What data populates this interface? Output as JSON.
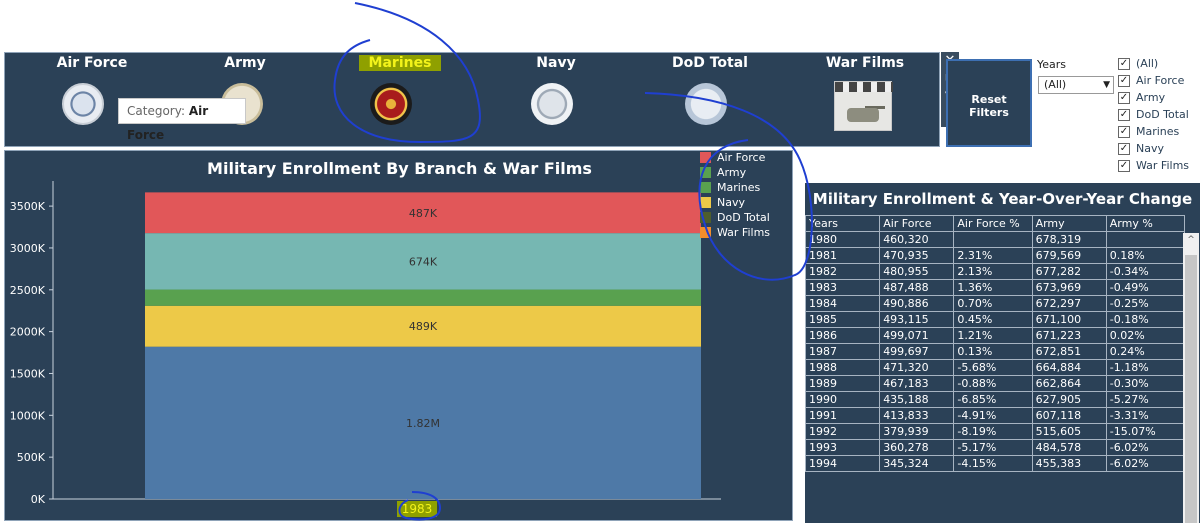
{
  "branches": [
    {
      "label": "Air Force",
      "center": 87,
      "seal": "air-force-seal"
    },
    {
      "label": "Army",
      "center": 240,
      "seal": "army-seal"
    },
    {
      "label": "Marines",
      "center": 395,
      "seal": "marines-seal"
    },
    {
      "label": "Navy",
      "center": 551,
      "seal": "navy-seal"
    },
    {
      "label": "DoD Total",
      "center": 705,
      "seal": "dod-seal"
    },
    {
      "label": "War Films",
      "center": 860,
      "seal": "war-films-image"
    }
  ],
  "active_branch": "Marines",
  "tooltip": {
    "prefix": "Category:",
    "value": "Air Force"
  },
  "reset_button": {
    "line1": "Reset",
    "line2": "Filters"
  },
  "years_filter": {
    "label": "Years",
    "selected": "(All)"
  },
  "filter_checklist": [
    "(All)",
    "Air Force",
    "Army",
    "DoD Total",
    "Marines",
    "Navy",
    "War Films"
  ],
  "chart_title": "Military Enrollment By Branch & War Films",
  "legend": [
    {
      "label": "Air Force",
      "color": "#e05759"
    },
    {
      "label": "Army",
      "color": "#59a14f"
    },
    {
      "label": "Marines",
      "color": "#59a14f"
    },
    {
      "label": "Navy",
      "color": "#edc948"
    },
    {
      "label": "DoD Total",
      "color": "#4e5e2c"
    },
    {
      "label": "War Films",
      "color": "#f28e2b"
    }
  ],
  "chart_data": {
    "type": "bar",
    "stacked": true,
    "categories": [
      "1983"
    ],
    "series": [
      {
        "name": "DoD Total",
        "values": [
          1820000
        ],
        "color": "#4e79a7",
        "label": "1.82M"
      },
      {
        "name": "Navy",
        "values": [
          489000
        ],
        "color": "#edc948",
        "label": "489K"
      },
      {
        "name": "Marines",
        "values": [
          194000
        ],
        "color": "#59a14f",
        "label": ""
      },
      {
        "name": "Army",
        "values": [
          674000
        ],
        "color": "#76b7b2",
        "label": "674K"
      },
      {
        "name": "Air Force",
        "values": [
          487000
        ],
        "color": "#e15759",
        "label": "487K"
      }
    ],
    "yticks": [
      "0K",
      "500K",
      "1000K",
      "1500K",
      "2000K",
      "2500K",
      "3000K",
      "3500K"
    ],
    "ylim": [
      0,
      3800000
    ]
  },
  "table": {
    "title": "Military Enrollment & Year-Over-Year Change",
    "headers": [
      "Years",
      "Air Force",
      "Air Force %",
      "Army",
      "Army %"
    ],
    "rows": [
      [
        "1980",
        "460,320",
        "",
        "678,319",
        ""
      ],
      [
        "1981",
        "470,935",
        "2.31%",
        "679,569",
        "0.18%"
      ],
      [
        "1982",
        "480,955",
        "2.13%",
        "677,282",
        "-0.34%"
      ],
      [
        "1983",
        "487,488",
        "1.36%",
        "673,969",
        "-0.49%"
      ],
      [
        "1984",
        "490,886",
        "0.70%",
        "672,297",
        "-0.25%"
      ],
      [
        "1985",
        "493,115",
        "0.45%",
        "671,100",
        "-0.18%"
      ],
      [
        "1986",
        "499,071",
        "1.21%",
        "671,223",
        "0.02%"
      ],
      [
        "1987",
        "499,697",
        "0.13%",
        "672,851",
        "0.24%"
      ],
      [
        "1988",
        "471,320",
        "-5.68%",
        "664,884",
        "-1.18%"
      ],
      [
        "1989",
        "467,183",
        "-0.88%",
        "662,864",
        "-0.30%"
      ],
      [
        "1990",
        "435,188",
        "-6.85%",
        "627,905",
        "-5.27%"
      ],
      [
        "1991",
        "413,833",
        "-4.91%",
        "607,118",
        "-3.31%"
      ],
      [
        "1992",
        "379,939",
        "-8.19%",
        "515,605",
        "-15.07%"
      ],
      [
        "1993",
        "360,278",
        "-5.17%",
        "484,578",
        "-6.02%"
      ],
      [
        "1994",
        "345,324",
        "-4.15%",
        "455,383",
        "-6.02%"
      ]
    ]
  }
}
